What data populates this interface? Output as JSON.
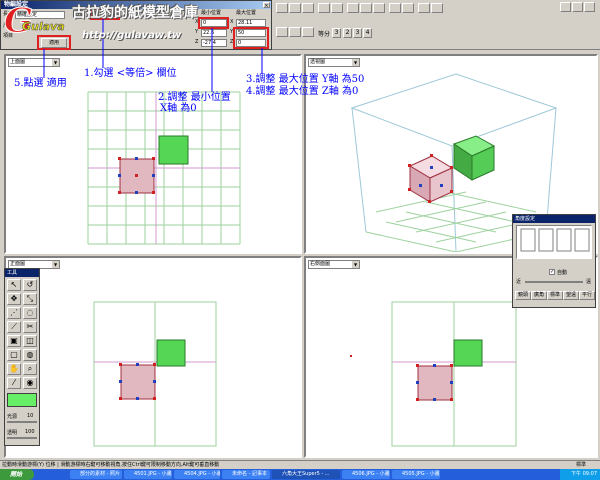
{
  "dialog": {
    "title": "物編設定",
    "field_length": "長度",
    "field_item": "項目",
    "combo_value": "精確設定",
    "label_size": "大小",
    "checkbox_label": "等倍",
    "label_angle": "角度",
    "label_center": "中心位置",
    "label_min": "最小位置",
    "label_max": "最大位置",
    "axis_x": "X",
    "axis_y": "Y",
    "axis_z": "Z",
    "min_x": "0",
    "min_y": "22.6",
    "min_z": "-27.4",
    "max_x": "28.11",
    "max_y": "50",
    "max_z": "0",
    "row_label_a": "尺規",
    "row_label_b": "描",
    "apply_button": "適用",
    "close_icon_glyph": "×"
  },
  "toolbar": {
    "scale_label": "等分",
    "scale_value": "3",
    "view_buttons": [
      "2",
      "3",
      "4"
    ]
  },
  "watermark": {
    "logo_text": "Gulava",
    "site_name": "古拉豹的紙模型倉庫",
    "url": "http://gulavaw.tw"
  },
  "annotations": {
    "step1": "1.勾選 <等倍> 欄位",
    "step2_line1": "2.調整 最小位置",
    "step2_line2": "X軸 為0",
    "step3_line1": "3.調整 最大位置 Y軸 為50",
    "step3_line2": "4.調整 最大位置 Z軸 為0",
    "step5": "5.點選 適用"
  },
  "viewports": {
    "top": "上面圖",
    "perspective": "透視圖",
    "front": "正面圖",
    "side": "右側面圖"
  },
  "tool_panel": {
    "title": "工具",
    "label_light": "光源",
    "light_value": "10",
    "label_alpha": "透明",
    "alpha_value": "100",
    "swatch_color": "#66ee66"
  },
  "angle_panel": {
    "title": "角度設定",
    "checkbox_label": "自動",
    "label_near": "近",
    "label_far": "遠",
    "buttons": [
      "鏡頭",
      "廣角",
      "標準",
      "望遠",
      "平行"
    ]
  },
  "status": {
    "text": "拉動時滑動游標(Y)  位移  |  滑動游標時右鍵可移動視角,按住Ctrl鍵可限制移動方向,Alt鍵可垂直移動",
    "right_text": "標準"
  },
  "taskbar": {
    "start_label": "開始",
    "tasks": [
      "部分的素材 - 照片",
      "4501.JPG - 小畫家",
      "4504.JPG - 小畫家",
      "未命名 - 記事本",
      "六角大王Super5 - ...",
      "4506.JPG - 小畫家",
      "4505.JPG - 小畫家"
    ],
    "tray_time": "下午 09:07"
  },
  "colors": {
    "selected_cube": "#e2b8c0",
    "green_cube": "#55d655",
    "grid": "#9ed29e",
    "axis": "#d09ad0",
    "annotation": "#0000ff",
    "highlight": "#e02020"
  }
}
